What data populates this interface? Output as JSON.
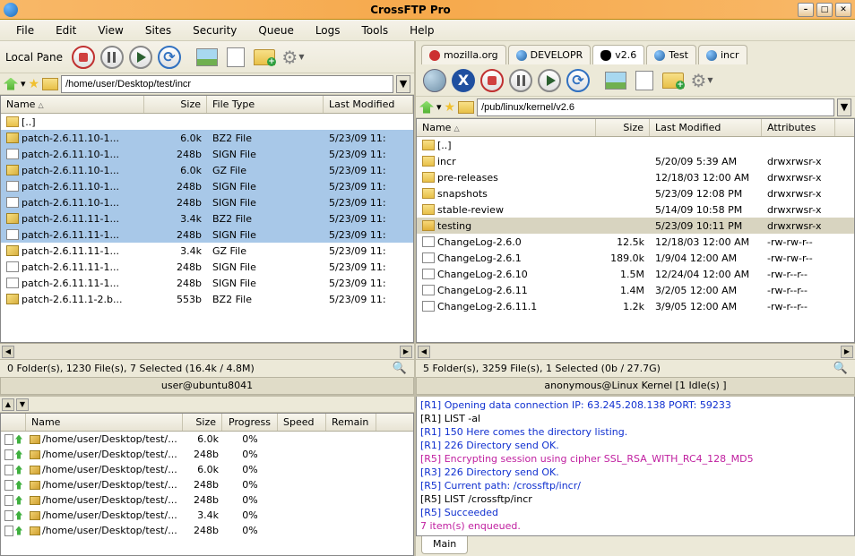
{
  "title": "CrossFTP Pro",
  "menu": [
    "File",
    "Edit",
    "View",
    "Sites",
    "Security",
    "Queue",
    "Logs",
    "Tools",
    "Help"
  ],
  "local": {
    "label": "Local Pane",
    "path": "/home/user/Desktop/test/incr",
    "columns": {
      "name": "Name",
      "size": "Size",
      "type": "File Type",
      "modified": "Last Modified"
    },
    "rows": [
      {
        "icon": "folder",
        "name": "[..]",
        "size": "",
        "type": "",
        "modified": "",
        "sel": false
      },
      {
        "icon": "bz2",
        "name": "patch-2.6.11.10-1...",
        "size": "6.0k",
        "type": "BZ2 File",
        "modified": "5/23/09 11:",
        "sel": true
      },
      {
        "icon": "file",
        "name": "patch-2.6.11.10-1...",
        "size": "248b",
        "type": "SIGN File",
        "modified": "5/23/09 11:",
        "sel": true
      },
      {
        "icon": "gz",
        "name": "patch-2.6.11.10-1...",
        "size": "6.0k",
        "type": "GZ File",
        "modified": "5/23/09 11:",
        "sel": true
      },
      {
        "icon": "file",
        "name": "patch-2.6.11.10-1...",
        "size": "248b",
        "type": "SIGN File",
        "modified": "5/23/09 11:",
        "sel": true
      },
      {
        "icon": "file",
        "name": "patch-2.6.11.10-1...",
        "size": "248b",
        "type": "SIGN File",
        "modified": "5/23/09 11:",
        "sel": true
      },
      {
        "icon": "bz2",
        "name": "patch-2.6.11.11-1...",
        "size": "3.4k",
        "type": "BZ2 File",
        "modified": "5/23/09 11:",
        "sel": true
      },
      {
        "icon": "file",
        "name": "patch-2.6.11.11-1...",
        "size": "248b",
        "type": "SIGN File",
        "modified": "5/23/09 11:",
        "sel": true
      },
      {
        "icon": "gz",
        "name": "patch-2.6.11.11-1...",
        "size": "3.4k",
        "type": "GZ File",
        "modified": "5/23/09 11:",
        "sel": false
      },
      {
        "icon": "file",
        "name": "patch-2.6.11.11-1...",
        "size": "248b",
        "type": "SIGN File",
        "modified": "5/23/09 11:",
        "sel": false
      },
      {
        "icon": "file",
        "name": "patch-2.6.11.11-1...",
        "size": "248b",
        "type": "SIGN File",
        "modified": "5/23/09 11:",
        "sel": false
      },
      {
        "icon": "bz2",
        "name": "patch-2.6.11.1-2.b...",
        "size": "553b",
        "type": "BZ2 File",
        "modified": "5/23/09 11:",
        "sel": false
      }
    ],
    "status": "0 Folder(s), 1230 File(s), 7 Selected (16.4k / 4.8M)",
    "user": "user@ubuntu8041"
  },
  "remote": {
    "tabs": [
      {
        "label": "mozilla.org",
        "icon": "red"
      },
      {
        "label": "DEVELOPR",
        "icon": "blue"
      },
      {
        "label": "v2.6",
        "icon": "penguin"
      },
      {
        "label": "Test",
        "icon": "blue"
      },
      {
        "label": "incr",
        "icon": "blue"
      }
    ],
    "path": "/pub/linux/kernel/v2.6",
    "columns": {
      "name": "Name",
      "size": "Size",
      "modified": "Last Modified",
      "attr": "Attributes"
    },
    "rows": [
      {
        "icon": "folder",
        "name": "[..]",
        "size": "",
        "modified": "",
        "attr": "",
        "sel": false,
        "hl": false
      },
      {
        "icon": "folder",
        "name": "incr",
        "size": "",
        "modified": "5/20/09 5:39 AM",
        "attr": "drwxrwsr-x",
        "sel": false,
        "hl": false
      },
      {
        "icon": "folder",
        "name": "pre-releases",
        "size": "",
        "modified": "12/18/03 12:00 AM",
        "attr": "drwxrwsr-x",
        "sel": false,
        "hl": false
      },
      {
        "icon": "folder",
        "name": "snapshots",
        "size": "",
        "modified": "5/23/09 12:08 PM",
        "attr": "drwxrwsr-x",
        "sel": false,
        "hl": false
      },
      {
        "icon": "folder",
        "name": "stable-review",
        "size": "",
        "modified": "5/14/09 10:58 PM",
        "attr": "drwxrwsr-x",
        "sel": false,
        "hl": false
      },
      {
        "icon": "folderopen",
        "name": "testing",
        "size": "",
        "modified": "5/23/09 10:11 PM",
        "attr": "drwxrwsr-x",
        "sel": false,
        "hl": true
      },
      {
        "icon": "file",
        "name": "ChangeLog-2.6.0",
        "size": "12.5k",
        "modified": "12/18/03 12:00 AM",
        "attr": "-rw-rw-r--",
        "sel": false,
        "hl": false
      },
      {
        "icon": "file",
        "name": "ChangeLog-2.6.1",
        "size": "189.0k",
        "modified": "1/9/04 12:00 AM",
        "attr": "-rw-rw-r--",
        "sel": false,
        "hl": false
      },
      {
        "icon": "file",
        "name": "ChangeLog-2.6.10",
        "size": "1.5M",
        "modified": "12/24/04 12:00 AM",
        "attr": "-rw-r--r--",
        "sel": false,
        "hl": false
      },
      {
        "icon": "file",
        "name": "ChangeLog-2.6.11",
        "size": "1.4M",
        "modified": "3/2/05 12:00 AM",
        "attr": "-rw-r--r--",
        "sel": false,
        "hl": false
      },
      {
        "icon": "file",
        "name": "ChangeLog-2.6.11.1",
        "size": "1.2k",
        "modified": "3/9/05 12:00 AM",
        "attr": "-rw-r--r--",
        "sel": false,
        "hl": false
      }
    ],
    "status": "5 Folder(s), 3259 File(s), 1 Selected (0b / 27.7G)",
    "user": "anonymous@Linux Kernel [1 Idle(s) ]"
  },
  "queue": {
    "columns": {
      "name": "Name",
      "size": "Size",
      "progress": "Progress",
      "speed": "Speed",
      "remain": "Remain"
    },
    "rows": [
      {
        "name": "/home/user/Desktop/test/...",
        "size": "6.0k",
        "progress": "0%"
      },
      {
        "name": "/home/user/Desktop/test/...",
        "size": "248b",
        "progress": "0%"
      },
      {
        "name": "/home/user/Desktop/test/...",
        "size": "6.0k",
        "progress": "0%"
      },
      {
        "name": "/home/user/Desktop/test/...",
        "size": "248b",
        "progress": "0%"
      },
      {
        "name": "/home/user/Desktop/test/...",
        "size": "248b",
        "progress": "0%"
      },
      {
        "name": "/home/user/Desktop/test/...",
        "size": "3.4k",
        "progress": "0%"
      },
      {
        "name": "/home/user/Desktop/test/...",
        "size": "248b",
        "progress": "0%"
      }
    ]
  },
  "log": {
    "lines": [
      {
        "cls": "blue",
        "text": "[R1] Opening data connection IP: 63.245.208.138 PORT: 59233"
      },
      {
        "cls": "black",
        "text": "[R1] LIST -al"
      },
      {
        "cls": "blue",
        "text": "[R1] 150 Here comes the directory listing."
      },
      {
        "cls": "blue",
        "text": "[R1] 226 Directory send OK."
      },
      {
        "cls": "magenta",
        "text": "[R5] Encrypting session using cipher SSL_RSA_WITH_RC4_128_MD5"
      },
      {
        "cls": "blue",
        "text": "[R3] 226 Directory send OK."
      },
      {
        "cls": "blue",
        "text": "[R5] Current path: /crossftp/incr/"
      },
      {
        "cls": "black",
        "text": "[R5] LIST /crossftp/incr"
      },
      {
        "cls": "blue",
        "text": "[R5] Succeeded"
      },
      {
        "cls": "magenta",
        "text": "7 item(s) enqueued."
      }
    ],
    "tab": "Main"
  }
}
